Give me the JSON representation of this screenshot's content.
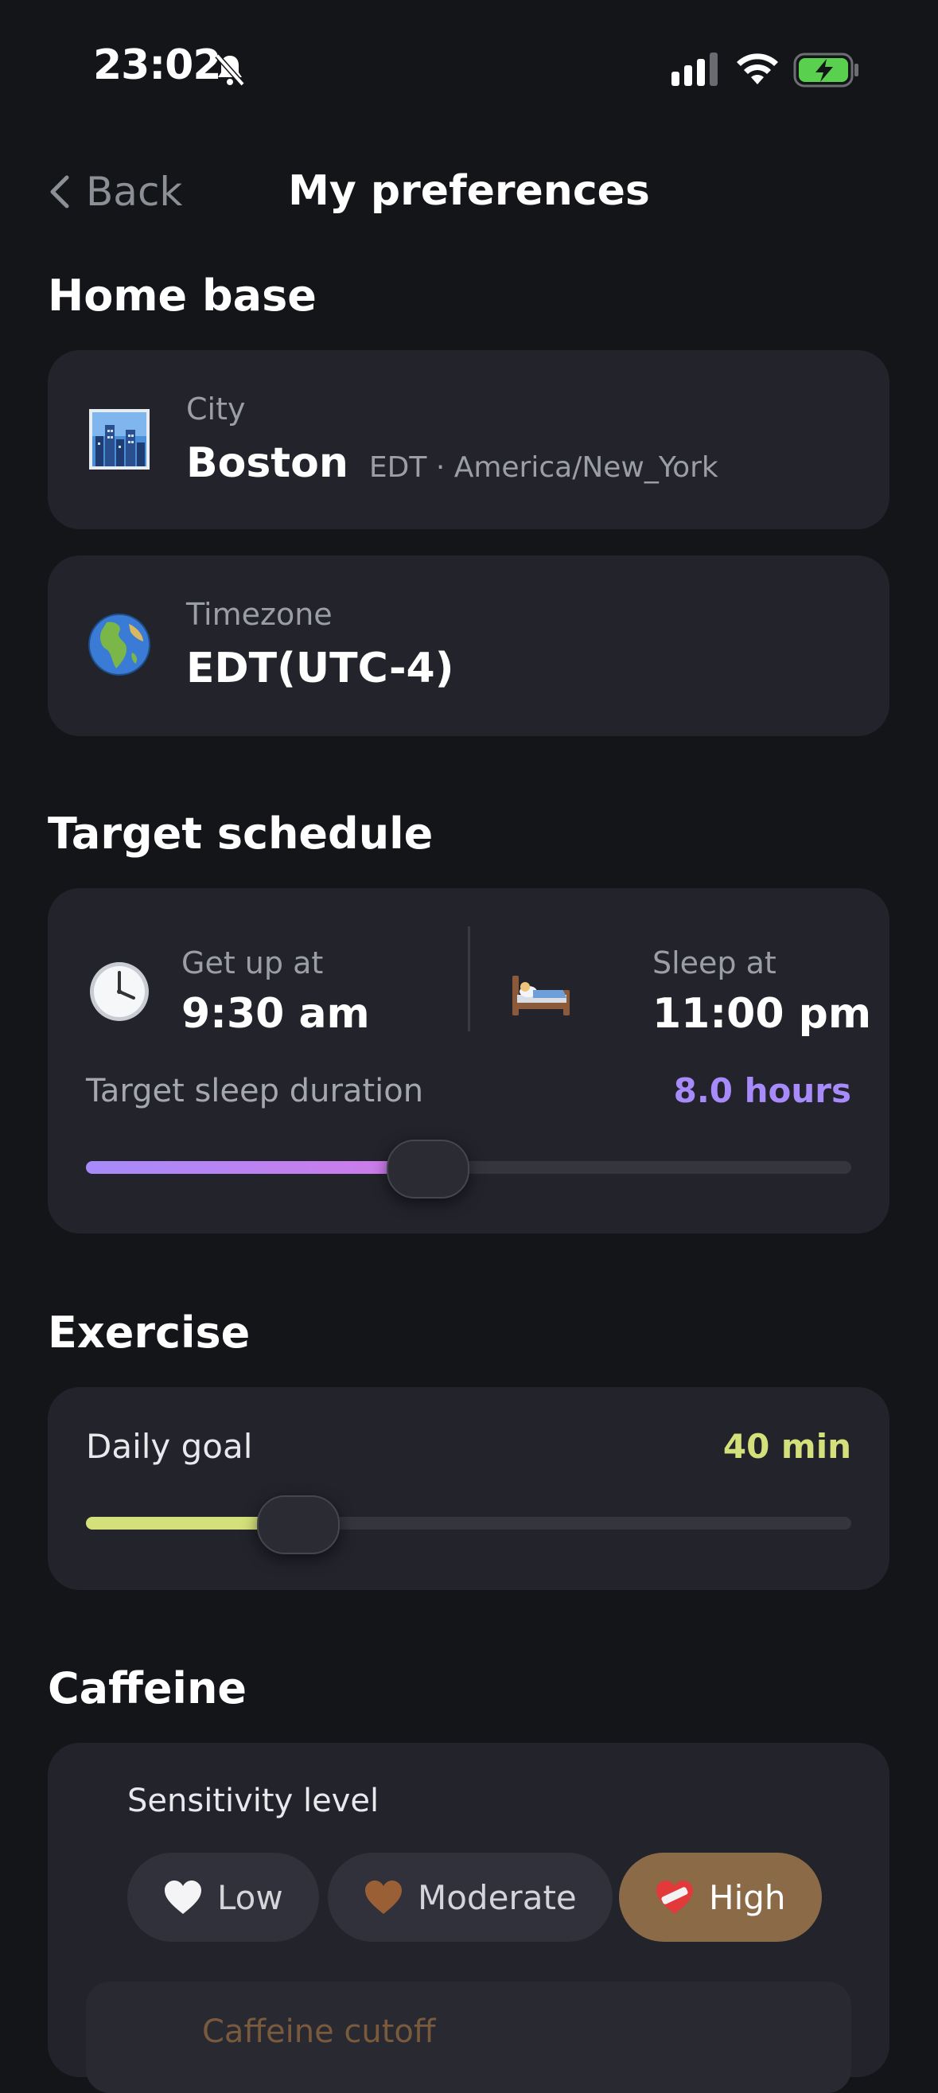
{
  "status_bar": {
    "time": "23:02"
  },
  "nav": {
    "back_label": "Back",
    "title": "My preferences"
  },
  "home_base": {
    "heading": "Home base",
    "city": {
      "label": "City",
      "value": "Boston",
      "detail": "EDT · America/New_York",
      "icon": "cityscape-icon"
    },
    "timezone": {
      "label": "Timezone",
      "value": "EDT(UTC-4)",
      "icon": "globe-icon"
    }
  },
  "target_schedule": {
    "heading": "Target schedule",
    "get_up": {
      "label": "Get up at",
      "value": "9:30 am",
      "icon": "clock-icon"
    },
    "sleep": {
      "label": "Sleep at",
      "value": "11:00 pm",
      "icon": "bed-icon"
    },
    "duration": {
      "label": "Target sleep duration",
      "value": "8.0 hours",
      "level": 0.435,
      "accent": "#a78bfa"
    }
  },
  "exercise": {
    "heading": "Exercise",
    "daily_goal": {
      "label": "Daily goal",
      "value": "40 min",
      "level": 0.265,
      "accent": "#d4e07a"
    }
  },
  "caffeine": {
    "heading": "Caffeine",
    "sensitivity_label": "Sensitivity level",
    "options": [
      {
        "label": "Low",
        "icon": "white-heart-icon",
        "selected": false
      },
      {
        "label": "Moderate",
        "icon": "brown-heart-icon",
        "selected": false
      },
      {
        "label": "High",
        "icon": "mending-heart-icon",
        "selected": true
      }
    ],
    "cutoff_label": "Caffeine cutoff"
  }
}
